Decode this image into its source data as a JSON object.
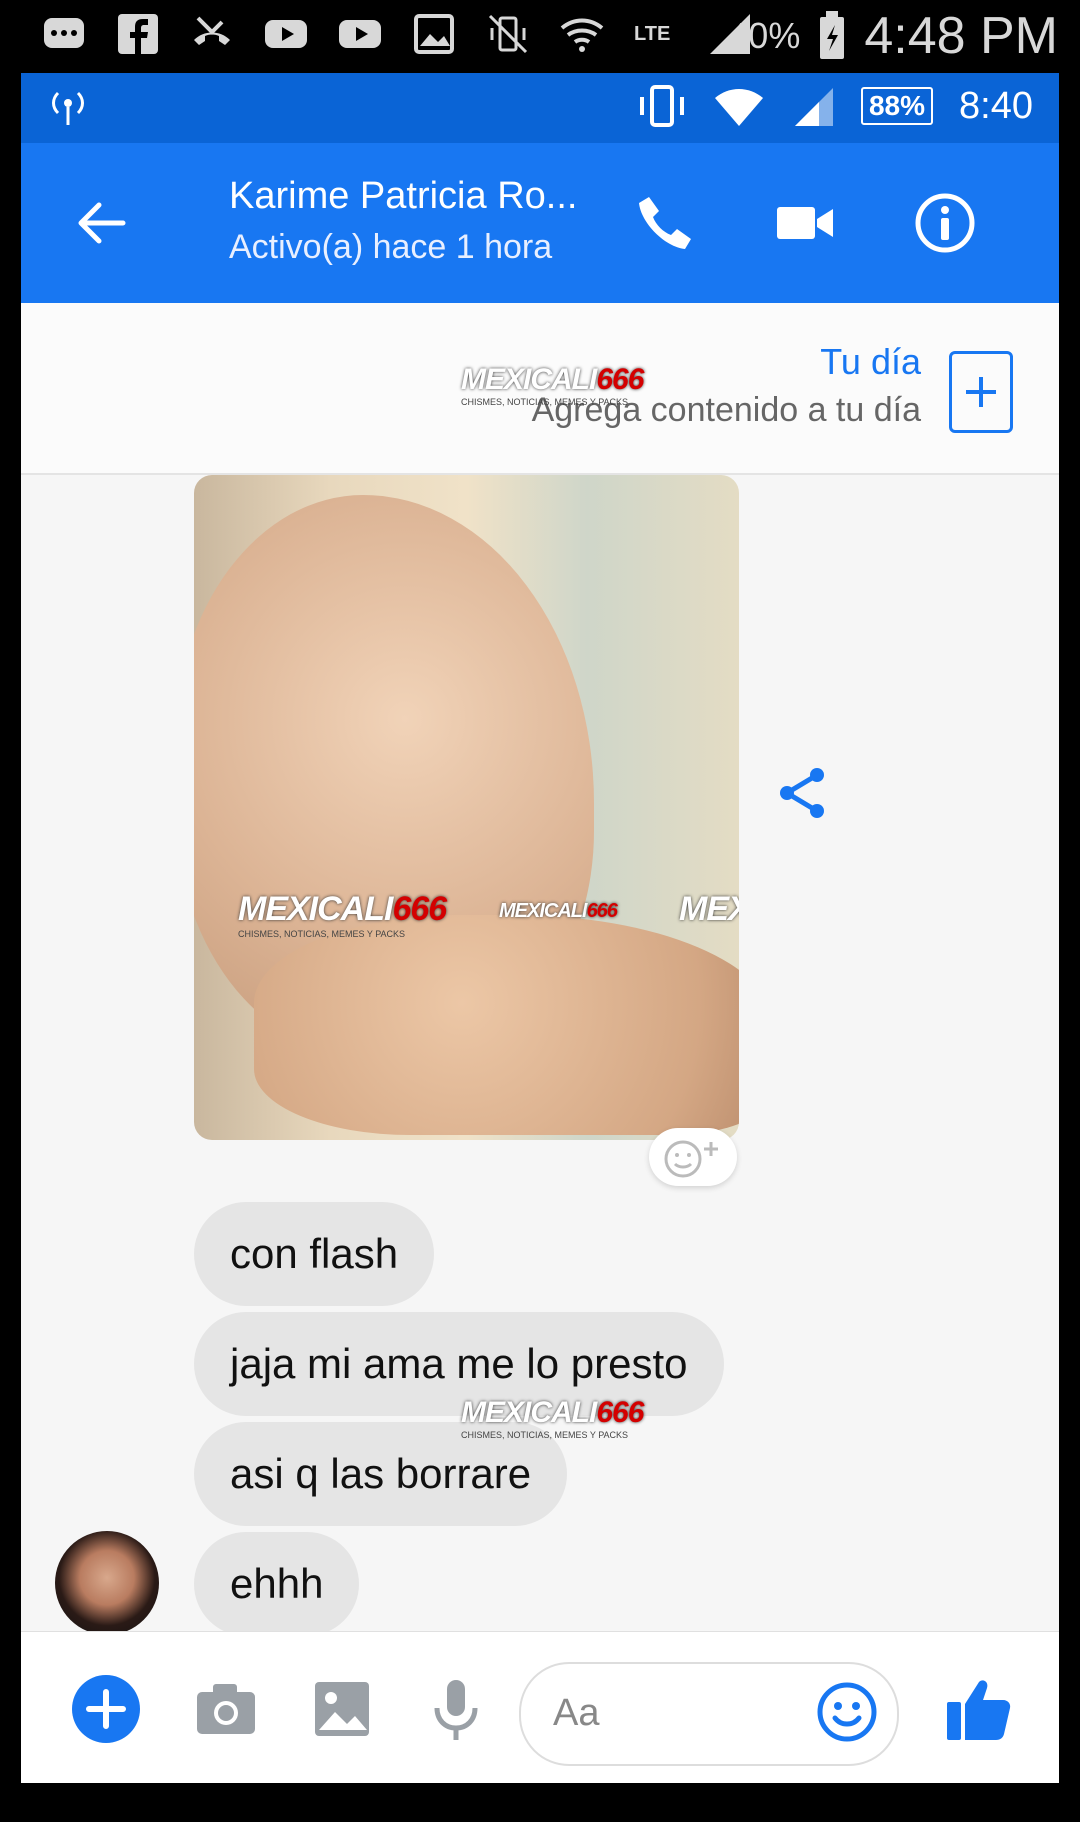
{
  "outer_status": {
    "battery_percent": "40%",
    "time": "4:48 PM",
    "icons": [
      "chat-bubble-icon",
      "facebook-icon",
      "missed-call-icon",
      "youtube-icon",
      "youtube-icon",
      "image-icon",
      "vibrate-off-icon",
      "wifi-icon",
      "lte-icon",
      "signal-icon",
      "battery-icon"
    ]
  },
  "inner_status": {
    "battery_percent": "88%",
    "time": "8:40",
    "icons": [
      "hotspot-icon",
      "vibrate-icon",
      "wifi-icon",
      "signal-icon",
      "battery-icon"
    ]
  },
  "header": {
    "contact_name": "Karime Patricia Ro...",
    "status": "Activo(a) hace 1 hora",
    "actions": [
      "back-arrow-icon",
      "phone-icon",
      "video-camera-icon",
      "info-icon"
    ]
  },
  "story": {
    "title": "Tu día",
    "subtitle": "Agrega contenido a tu día"
  },
  "watermark": {
    "brand_a": "MEXICALI",
    "brand_b": "666",
    "tagline": "CHISMES, NOTICIAS, MEMES Y PACKS"
  },
  "messages": [
    {
      "text": "con flash"
    },
    {
      "text": "jaja mi ama me lo presto"
    },
    {
      "text": "asi q  las borrare"
    },
    {
      "text": "ehhh"
    }
  ],
  "composer": {
    "placeholder": "Aa",
    "actions": [
      "plus-icon",
      "camera-icon",
      "image-icon",
      "microphone-icon",
      "emoji-icon",
      "thumbs-up-icon"
    ]
  },
  "colors": {
    "messenger_blue": "#1877f2",
    "status_blue": "#0a64d6",
    "bubble_gray": "#e5e5e5",
    "watermark_red": "#d40000"
  }
}
